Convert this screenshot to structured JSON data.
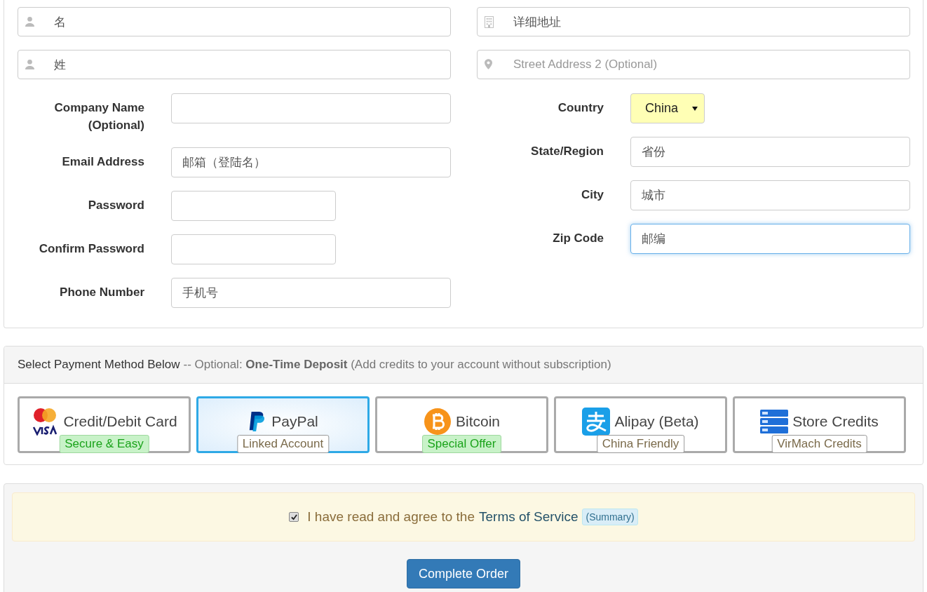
{
  "name_fields": [
    {
      "kind": "person",
      "value": "名"
    },
    {
      "kind": "building",
      "value": "详细地址"
    },
    {
      "kind": "person",
      "value": "姓"
    },
    {
      "kind": "pin",
      "placeholder": "Street Address 2 (Optional)"
    }
  ],
  "left_fields": [
    {
      "label": "Company Name (Optional)",
      "kind": "wide",
      "focused": false
    },
    {
      "label": "Email Address",
      "value": "邮箱（登陆名）",
      "kind": "wide",
      "focused": false
    },
    {
      "label": "Password",
      "kind": "narrow",
      "focused": false
    },
    {
      "label": "Confirm Password",
      "kind": "narrow",
      "focused": false
    },
    {
      "label": "Phone Number",
      "value": "手机号",
      "kind": "wide",
      "focused": false
    }
  ],
  "right_fields": [
    {
      "kind": "select",
      "label": "Country",
      "value": "China",
      "focused": false
    },
    {
      "kind": "input",
      "label": "State/Region",
      "value": "省份",
      "focused": false
    },
    {
      "kind": "input",
      "label": "City",
      "value": "城市",
      "focused": false
    },
    {
      "kind": "input",
      "label": "Zip Code",
      "value": "邮编",
      "focused": true
    }
  ],
  "payment": {
    "heading": "Select Payment Method Below",
    "note": "-- Optional: **One-Time Deposit** (Add credits to your account without subscription)",
    "methods": [
      {
        "kind": "card",
        "name": "Credit/Debit Card",
        "tag": "Secure & Easy",
        "tag_highlighted": true,
        "selected": false
      },
      {
        "kind": "paypal",
        "name": "PayPal",
        "tag": "Linked Account",
        "tag_highlighted": false,
        "selected": true
      },
      {
        "kind": "bitcoin",
        "name": "Bitcoin",
        "tag": "Special Offer",
        "tag_highlighted": true,
        "selected": false
      },
      {
        "kind": "alipay",
        "name": "Alipay (Beta)",
        "tag": "China Friendly",
        "tag_highlighted": false,
        "selected": false
      },
      {
        "kind": "credits",
        "name": "Store Credits",
        "tag": "VirMach Credits",
        "tag_highlighted": false,
        "selected": false
      }
    ]
  },
  "terms": {
    "checked": true,
    "text": "I have read and agree to the",
    "link": "Terms of Service",
    "badge": "(Summary)"
  },
  "submit": "Complete Order"
}
